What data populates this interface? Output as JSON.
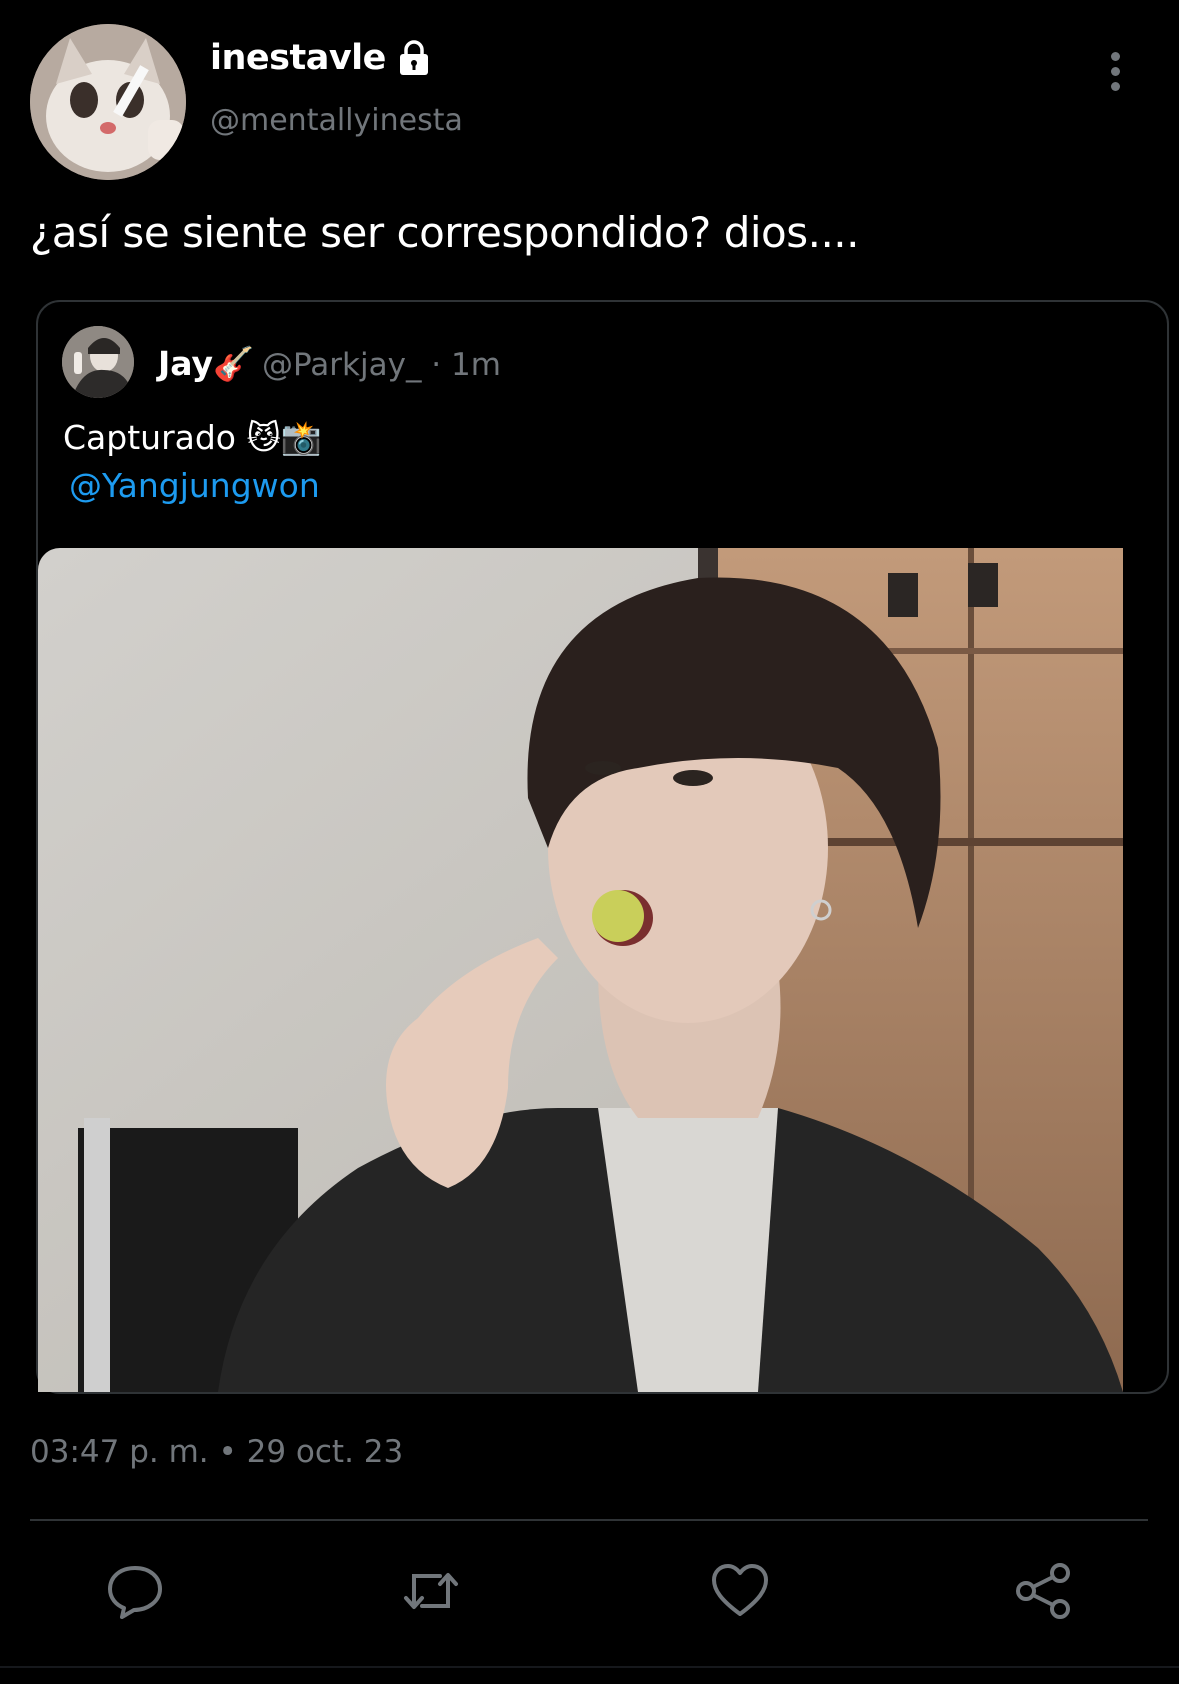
{
  "author": {
    "display_name": "inestavle",
    "handle": "@mentallyinesta",
    "avatar_icon": "cat-avatar",
    "protected_icon": "lock-icon"
  },
  "tweet": {
    "text": "¿así se siente ser correspondido? dios....",
    "timestamp": "03:47 p. m. • 29 oct. 23"
  },
  "quoted_tweet": {
    "display_name": "Jay🎸",
    "handle_time": "@Parkjay_ · 1m",
    "text": "Capturado 😼📸",
    "mention": "@Yangjungwon",
    "media_icon": "photo"
  },
  "actions": {
    "reply_icon": "reply-icon",
    "retweet_icon": "retweet-icon",
    "like_icon": "heart-icon",
    "share_icon": "share-icon"
  },
  "colors": {
    "background": "#000000",
    "text_primary": "#ffffff",
    "text_secondary": "#71767b",
    "link": "#1d9bf0",
    "border": "#2f3336"
  }
}
